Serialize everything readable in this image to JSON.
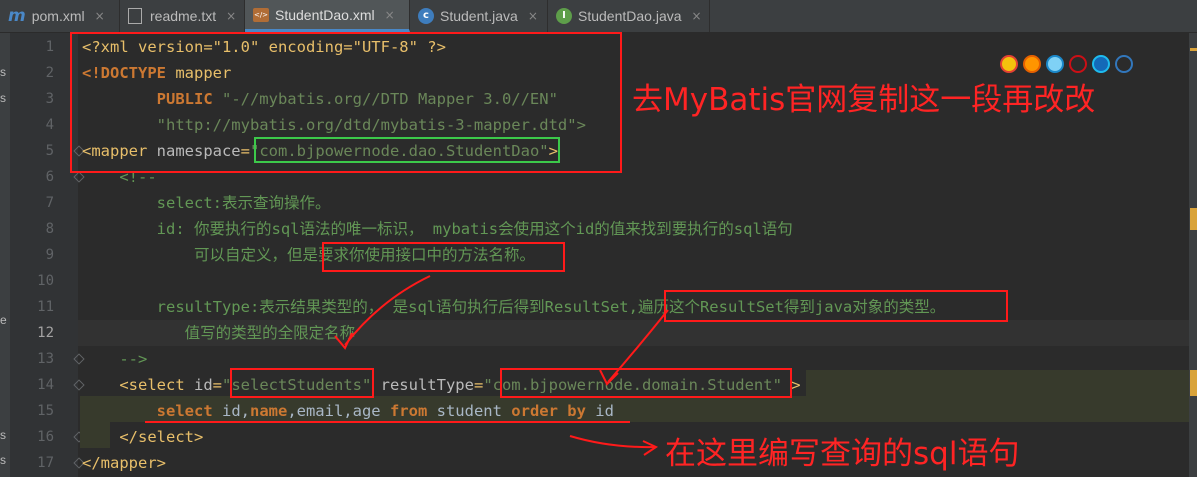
{
  "tabs": [
    {
      "label": "pom.xml",
      "icon": "maven-m-icon",
      "active": false
    },
    {
      "label": "readme.txt",
      "icon": "text-file-icon",
      "active": false
    },
    {
      "label": "StudentDao.xml",
      "icon": "xml-file-icon",
      "active": true
    },
    {
      "label": "Student.java",
      "icon": "java-class-icon",
      "active": false
    },
    {
      "label": "StudentDao.java",
      "icon": "java-interface-icon",
      "active": false
    }
  ],
  "tab_close_glyph": "×",
  "side_strip": [
    "s",
    "s",
    "e",
    "s",
    "s"
  ],
  "line_numbers": [
    "1",
    "2",
    "3",
    "4",
    "5",
    "6",
    "7",
    "8",
    "9",
    "10",
    "11",
    "12",
    "13",
    "14",
    "15",
    "16",
    "17"
  ],
  "code": {
    "l1": "<?xml version=\"1.0\" encoding=\"UTF-8\" ?>",
    "l2_a": "<!DOCTYPE ",
    "l2_b": "mapper",
    "l3_a": "        PUBLIC ",
    "l3_b": "\"-//mybatis.org//DTD Mapper 3.0//EN\"",
    "l4": "        \"http://mybatis.org/dtd/mybatis-3-mapper.dtd\">",
    "l5_a": "<mapper ",
    "l5_b": "namespace",
    "l5_c": "=",
    "l5_d": "\"com.bjpowernode.dao.StudentDao\"",
    "l5_e": ">",
    "l6": "    <!--",
    "l7": "        select:表示查询操作。",
    "l8": "        id: 你要执行的sql语法的唯一标识， mybatis会使用这个id的值来找到要执行的sql语句",
    "l9": "            可以自定义，但是要求你使用接口中的方法名称。",
    "l10": "",
    "l11": "        resultType:表示结果类型的， 是sql语句执行后得到ResultSet,遍历这个ResultSet得到java对象的类型。",
    "l12": "           值写的类型的全限定名称",
    "l13": "    -->",
    "l14_a": "    <select ",
    "l14_b": "id",
    "l14_c": "=",
    "l14_d": "\"selectStudents\"",
    "l14_e": " resultType",
    "l14_f": "=",
    "l14_g": "\"com.bjpowernode.domain.Student\"",
    "l14_h": " >",
    "l15_a": "        select ",
    "l15_b": "id,",
    "l15_c": "name",
    "l15_d": ",email,age ",
    "l15_e": "from ",
    "l15_f": "student ",
    "l15_g": "order by ",
    "l15_h": "id",
    "l16": "    </select>",
    "l17": "</mapper>"
  },
  "annotations": {
    "top_right": "去MyBatis官网复制这一段再改改",
    "bottom_right": "在这里编写查询的sql语句"
  },
  "browser_icons": [
    "chrome-icon",
    "firefox-icon",
    "safari-icon",
    "opera-icon",
    "ie-icon",
    "edge-icon"
  ],
  "colors": {
    "annotation_red": "#ff1a1a",
    "namespace_green": "#3cc84a",
    "active_tab_underline": "#4a88c7"
  }
}
